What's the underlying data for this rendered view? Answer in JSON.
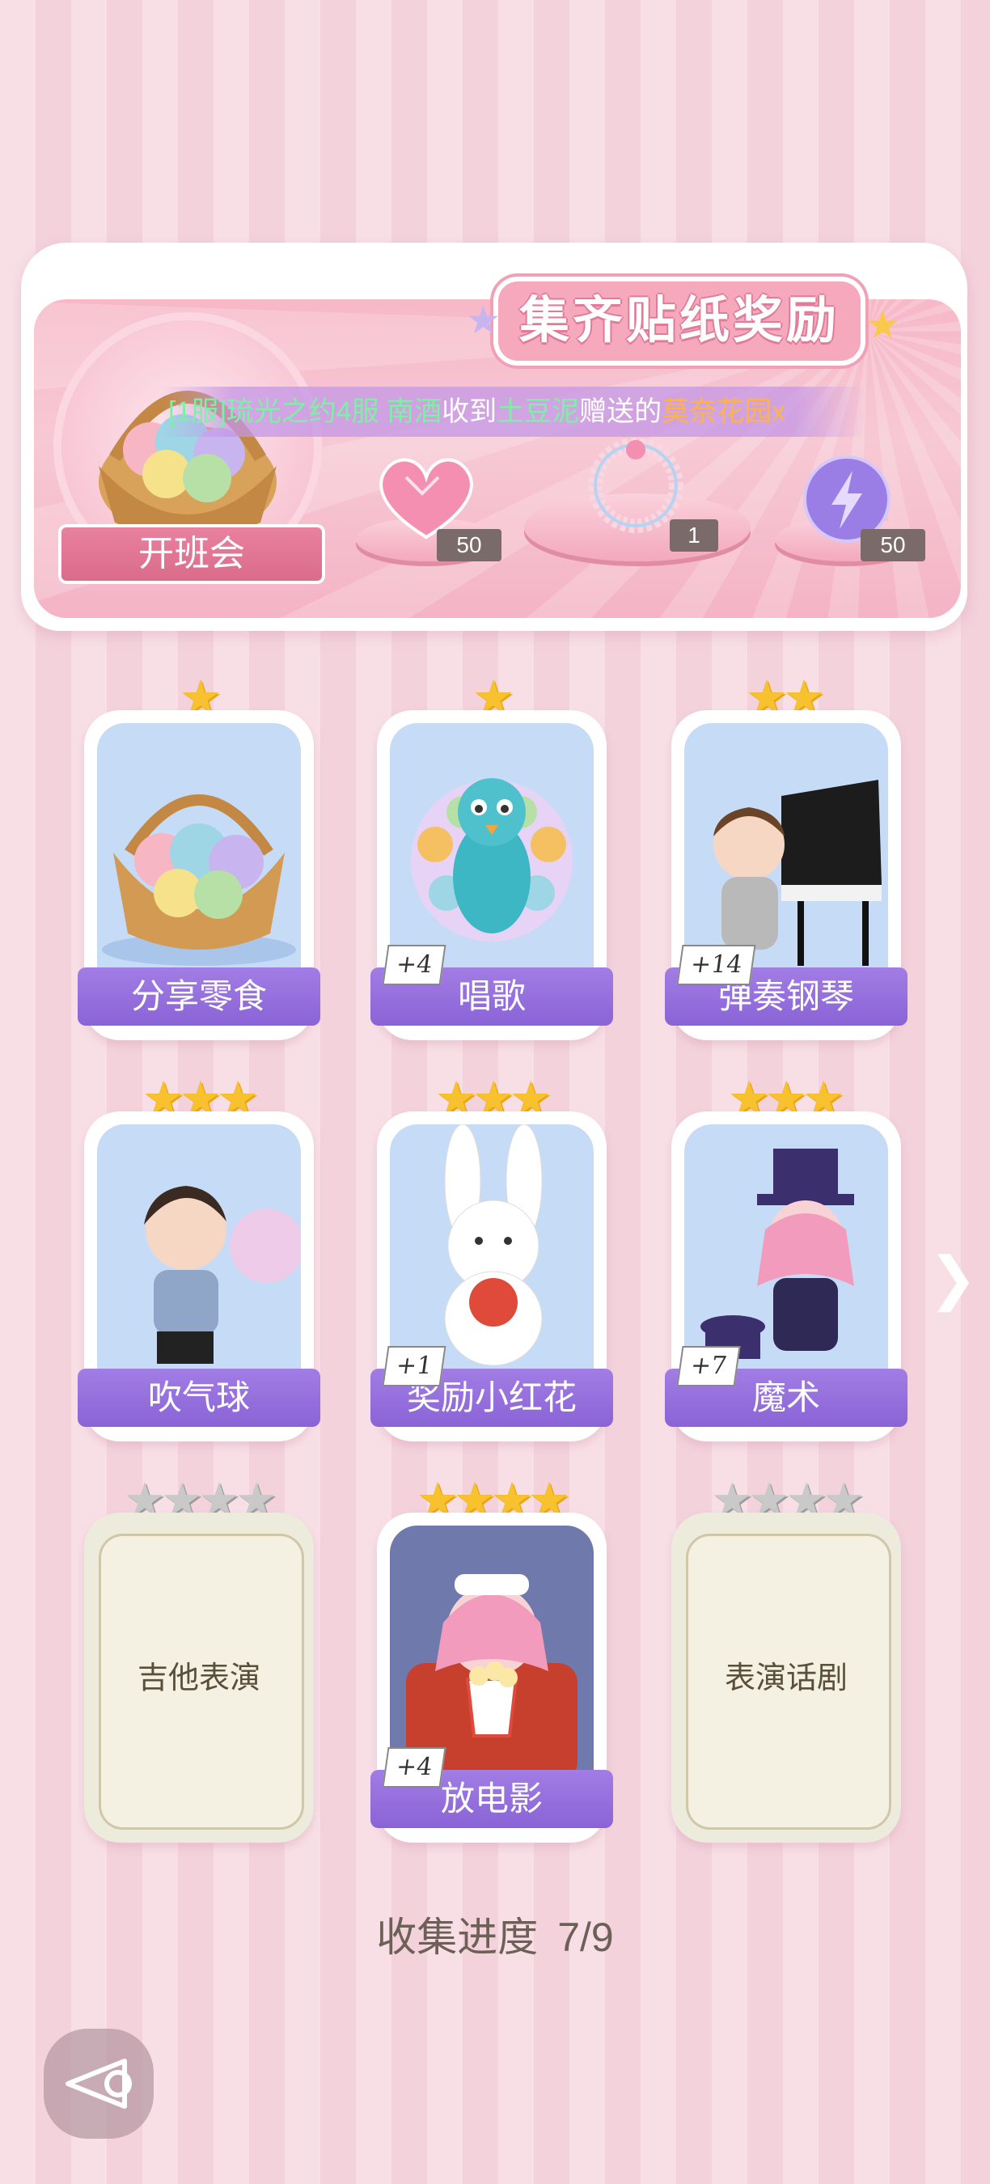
{
  "banner": {
    "title": "集齐贴纸奖励",
    "ticker": {
      "part1": "[1服]琉光之约4服 南酒",
      "part2": "收到",
      "part3": "土豆泥",
      "part4": "赠送的",
      "part5": "莫奈花园",
      "part6": "x"
    },
    "class_meeting_label": "开班会",
    "rewards": [
      {
        "name": "heart-gem",
        "count": "50"
      },
      {
        "name": "bracelet",
        "count": "1"
      },
      {
        "name": "lightning-orb",
        "count": "50"
      }
    ]
  },
  "cards": [
    {
      "label": "分享零食",
      "stars": 1,
      "plus": ""
    },
    {
      "label": "唱歌",
      "stars": 1,
      "plus": "+4"
    },
    {
      "label": "弹奏钢琴",
      "stars": 2,
      "plus": "+14"
    },
    {
      "label": "吹气球",
      "stars": 3,
      "plus": ""
    },
    {
      "label": "奖励小红花",
      "stars": 3,
      "plus": "+1"
    },
    {
      "label": "魔术",
      "stars": 3,
      "plus": "+7"
    },
    {
      "label": "吉他表演",
      "stars": 4,
      "plus": "",
      "locked": true
    },
    {
      "label": "放电影",
      "stars": 4,
      "plus": "+4"
    },
    {
      "label": "表演话剧",
      "stars": 4,
      "plus": "",
      "locked": true
    }
  ],
  "progress": {
    "label": "收集进度",
    "value": "7/9"
  },
  "colors": {
    "accent": "#8a63d6",
    "pink": "#f7b8c8",
    "gold": "#f8c12e"
  },
  "icons": {
    "next": "chevron-right-icon",
    "back": "back-icon"
  }
}
